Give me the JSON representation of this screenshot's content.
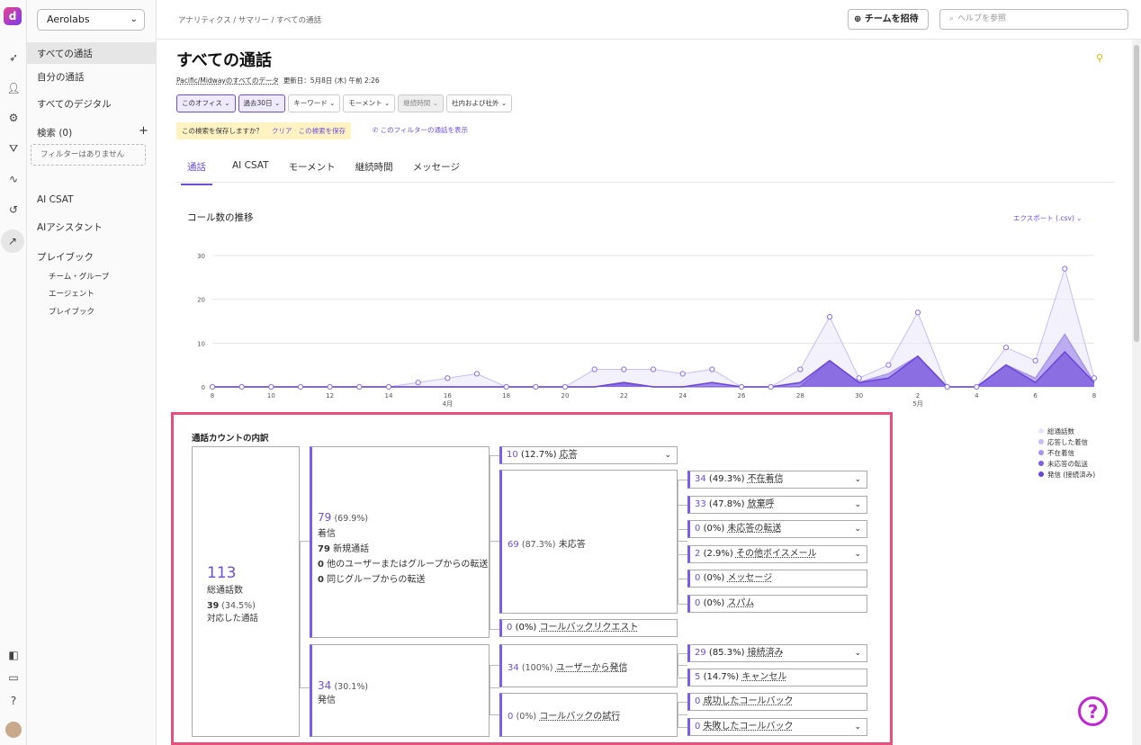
{
  "rail": {
    "logo": "d",
    "icons": [
      "rocket-icon",
      "user-icon",
      "gear-icon",
      "playbook-icon",
      "activity-icon",
      "history-icon",
      "trend-icon"
    ],
    "bottom_icons": [
      "app-icon",
      "video-icon",
      "help-icon",
      "avatar"
    ]
  },
  "sidebar": {
    "org": "Aerolabs",
    "items": [
      "すべての通話",
      "自分の通話",
      "すべてのデジタル"
    ],
    "search_label": "検索 (0)",
    "no_filters": "フィルターはありません",
    "ai_csat": "AI CSAT",
    "ai_assistant": "AIアシスタント",
    "playbook": "プレイブック",
    "subitems": [
      "チーム・グループ",
      "エージェント",
      "プレイブック"
    ]
  },
  "topbar": {
    "breadcrumb": "アナリティクス / サマリー / すべての通話",
    "invite": "チームを招待",
    "search_placeholder": "ヘルプを参照"
  },
  "page": {
    "title": "すべての通話",
    "scope": "Pacific/Midwayのすべてのデータ",
    "updated": "更新日：5月8日 (木) 午前 2:26",
    "filters": [
      "このオフィス",
      "過去30日",
      "キーワード",
      "モーメント",
      "継続時間",
      "社内および社外"
    ],
    "save_prompt": "この検索を保存しますか？",
    "clear": "クリア",
    "save_search": "この検索を保存",
    "show_calls": "このフィルターの通話を表示",
    "tabs": [
      "通話",
      "AI CSAT",
      "モーメント",
      "継続時間",
      "メッセージ"
    ]
  },
  "chart_data": {
    "type": "area",
    "title": "コール数の推移",
    "export": "エクスポート (.csv)",
    "x": [
      "4/8",
      "4/9",
      "4/10",
      "4/11",
      "4/12",
      "4/13",
      "4/14",
      "4/15",
      "4/16",
      "4/17",
      "4/18",
      "4/19",
      "4/20",
      "4/21",
      "4/22",
      "4/23",
      "4/24",
      "4/25",
      "4/26",
      "4/27",
      "4/28",
      "4/29",
      "4/30",
      "5/1",
      "5/2",
      "5/3",
      "5/4",
      "5/5",
      "5/6",
      "5/7",
      "5/8"
    ],
    "x_ticks": [
      "8",
      "10",
      "12",
      "14",
      "16",
      "18",
      "20",
      "22",
      "24",
      "26",
      "28",
      "30",
      "2",
      "4",
      "6",
      "8"
    ],
    "x_month_labels": [
      "4月",
      "5月"
    ],
    "ylim": [
      0,
      30
    ],
    "y_ticks": [
      "0",
      "10",
      "20",
      "30"
    ],
    "grid": true,
    "legend_position": "right",
    "series": [
      {
        "name": "総通話数",
        "color": "#e9e6f9",
        "values": [
          0,
          0,
          0,
          0,
          0,
          0,
          0,
          1,
          2,
          3,
          0,
          0,
          0,
          4,
          4,
          4,
          3,
          4,
          0,
          0,
          4,
          16,
          2,
          5,
          17,
          0,
          0,
          9,
          6,
          27,
          2
        ]
      },
      {
        "name": "応答した着信",
        "color": "#c9bdf3",
        "values": [
          0,
          0,
          0,
          0,
          0,
          0,
          0,
          0,
          0,
          0,
          0,
          0,
          0,
          0,
          0,
          0,
          0,
          0,
          0,
          0,
          0,
          0,
          0,
          0,
          0,
          0,
          0,
          0,
          0,
          0,
          0
        ]
      },
      {
        "name": "不在着信",
        "color": "#a994ec",
        "values": [
          0,
          0,
          0,
          0,
          0,
          0,
          0,
          0,
          0,
          0,
          0,
          0,
          0,
          0,
          1,
          0,
          0,
          0,
          0,
          0,
          0,
          6,
          1,
          3,
          7,
          0,
          0,
          5,
          2,
          12,
          1
        ]
      },
      {
        "name": "未応答の転送",
        "color": "#7f5fe0",
        "values": [
          0,
          0,
          0,
          0,
          0,
          0,
          0,
          0,
          0,
          0,
          0,
          0,
          0,
          0,
          0,
          0,
          0,
          0,
          0,
          0,
          0,
          0,
          0,
          0,
          0,
          0,
          0,
          0,
          0,
          0,
          0
        ]
      },
      {
        "name": "発信 (接続済み)",
        "color": "#6a45d8",
        "values": [
          0,
          0,
          0,
          0,
          0,
          0,
          0,
          0,
          0,
          0,
          0,
          0,
          0,
          0,
          1,
          0,
          0,
          1,
          0,
          0,
          1,
          6,
          1,
          2,
          7,
          0,
          0,
          5,
          1,
          8,
          1
        ]
      }
    ]
  },
  "breakdown": {
    "title": "通話カウントの内訳",
    "total": {
      "num": "113",
      "label": "総通話数",
      "sub_num": "39",
      "sub_pct": "(34.5%)",
      "sub_label": "対応した通話"
    },
    "inbound": {
      "num": "79",
      "pct": "(69.9%)",
      "label": "着信",
      "lines": [
        {
          "n": "79",
          "t": "新規通話"
        },
        {
          "n": "0",
          "t": "他のユーザーまたはグループからの転送"
        },
        {
          "n": "0",
          "t": "同じグループからの転送"
        }
      ]
    },
    "outbound": {
      "num": "34",
      "pct": "(30.1%)",
      "label": "発信"
    },
    "answered": {
      "num": "10",
      "pct": "(12.7%)",
      "label": "応答"
    },
    "unanswered": {
      "num": "69",
      "pct": "(87.3%)",
      "label": "未応答"
    },
    "callback_request": {
      "num": "0",
      "pct": "(0%)",
      "label": "コールバックリクエスト"
    },
    "unanswered_items": [
      {
        "num": "34",
        "pct": "(49.3%)",
        "label": "不在着信",
        "dd": true
      },
      {
        "num": "33",
        "pct": "(47.8%)",
        "label": "放棄呼",
        "dd": true
      },
      {
        "num": "0",
        "pct": "(0%)",
        "label": "未応答の転送",
        "dd": true
      },
      {
        "num": "2",
        "pct": "(2.9%)",
        "label": "その他ボイスメール",
        "dd": true
      },
      {
        "num": "0",
        "pct": "(0%)",
        "label": "メッセージ",
        "dd": false
      },
      {
        "num": "0",
        "pct": "(0%)",
        "label": "スパム",
        "dd": false
      }
    ],
    "user_outbound": {
      "num": "34",
      "pct": "(100%)",
      "label": "ユーザーから発信"
    },
    "callback_attempt": {
      "num": "0",
      "pct": "(0%)",
      "label": "コールバックの試行"
    },
    "user_outbound_items": [
      {
        "num": "29",
        "pct": "(85.3%)",
        "label": "接続済み",
        "dd": true
      },
      {
        "num": "5",
        "pct": "(14.7%)",
        "label": "キャンセル",
        "dd": false
      }
    ],
    "callback_items": [
      {
        "num": "0",
        "label": "成功したコールバック",
        "dd": false
      },
      {
        "num": "0",
        "label": "失敗したコールバック",
        "dd": true
      }
    ]
  }
}
